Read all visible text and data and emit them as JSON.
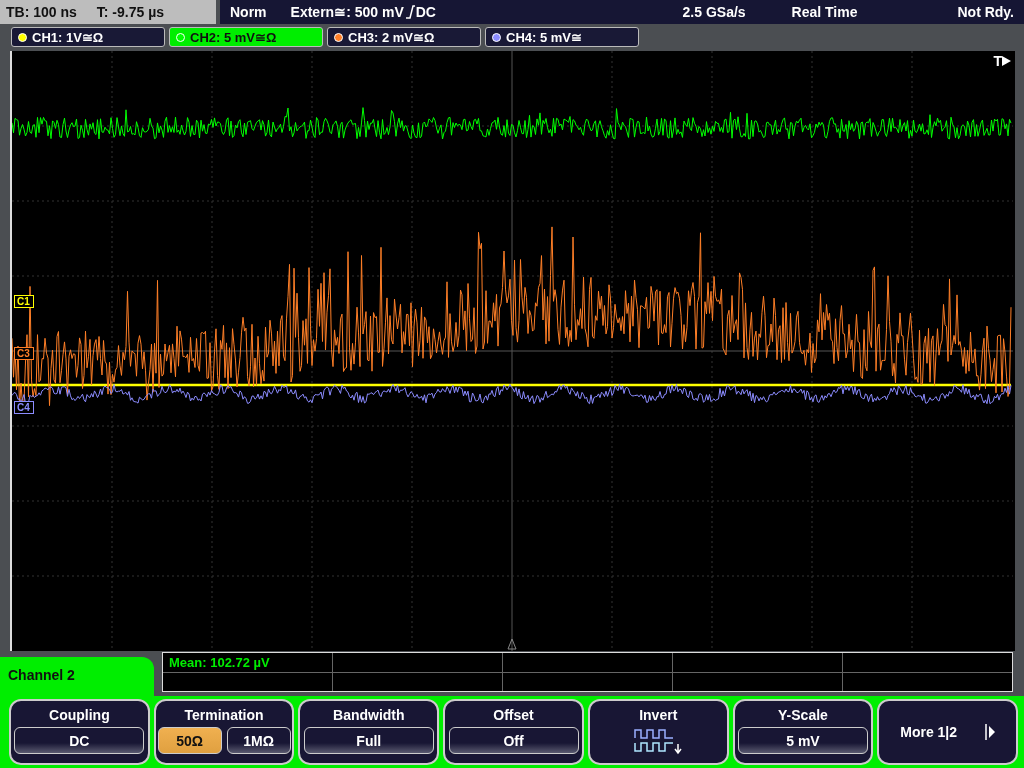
{
  "status_bar": {
    "timebase": "TB: 100 ns",
    "trigger_time": "T: -9.75 µs",
    "mode": "Norm",
    "trigger": "Extern≅: 500 mV",
    "trigger_coupling": "DC",
    "sample_rate": "2.5 GSa/s",
    "acquisition": "Real Time",
    "state": "Not Rdy."
  },
  "channels": [
    {
      "label": "CH1: 1V≅Ω",
      "color": "#ffff00",
      "selected": false
    },
    {
      "label": "CH2: 5 mV≅Ω",
      "color": "#00ff00",
      "selected": true
    },
    {
      "label": "CH3: 2 mV≅Ω",
      "color": "#ff7f27",
      "selected": false
    },
    {
      "label": "CH4: 5 mV≅",
      "color": "#8c8cff",
      "selected": false
    }
  ],
  "markers": [
    {
      "label": "C1",
      "color": "#ffff00"
    },
    {
      "label": "C3",
      "color": "#ff7f27"
    },
    {
      "label": "C4",
      "color": "#8c8cff"
    }
  ],
  "trigger_marker": "T",
  "measurement": "Mean: 102.72 µV",
  "menu_title": "Channel 2",
  "softkeys": [
    {
      "kind": "value",
      "title": "Coupling",
      "value": "DC"
    },
    {
      "kind": "choice",
      "title": "Termination",
      "options": [
        {
          "label": "50Ω",
          "selected": true
        },
        {
          "label": "1MΩ",
          "selected": false
        }
      ]
    },
    {
      "kind": "value",
      "title": "Bandwidth",
      "value": "Full"
    },
    {
      "kind": "value",
      "title": "Offset",
      "value": "Off"
    },
    {
      "kind": "icon",
      "title": "Invert"
    },
    {
      "kind": "value",
      "title": "Y-Scale",
      "value": "5 mV"
    },
    {
      "kind": "more",
      "title": "More 1|2"
    }
  ]
}
